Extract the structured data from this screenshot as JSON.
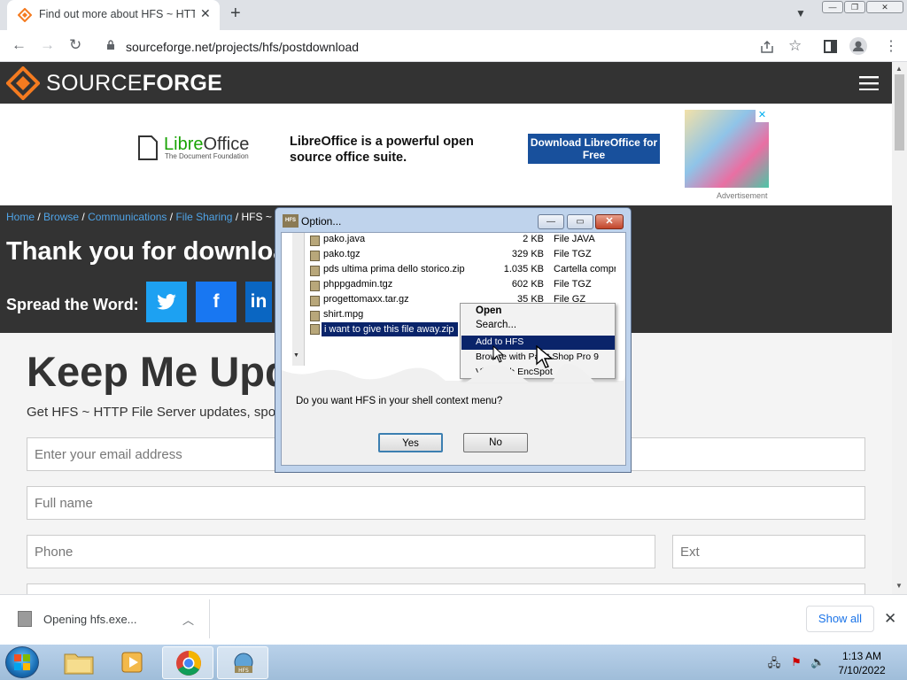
{
  "browser": {
    "tab_title": "Find out more about HFS ~ HTTP File Server",
    "url": "sourceforge.net/projects/hfs/postdownload"
  },
  "site": {
    "logo_light": "SOURCE",
    "logo_bold": "FORGE"
  },
  "ad": {
    "brand_a": "Libre",
    "brand_b": "Office",
    "brand_sub": "The Document Foundation",
    "text": "LibreOffice is a powerful open source office suite.",
    "cta": "Download LibreOffice for Free",
    "label": "Advertisement"
  },
  "breadcrumb": {
    "items": [
      "Home",
      "Browse",
      "Communications",
      "File Sharing"
    ],
    "current": "HFS ~ HTTP File Server"
  },
  "page": {
    "thanks": "Thank you for downloading",
    "spread": "Spread the Word:",
    "keep_me": "Keep Me Updated",
    "get_updates": "Get HFS ~ HTTP File Server updates, sponsored content from our select partners, and more."
  },
  "form": {
    "email_placeholder": "Enter your email address",
    "name_placeholder": "Full name",
    "phone_placeholder": "Phone",
    "ext_placeholder": "Ext"
  },
  "download_bar": {
    "file_text": "Opening hfs.exe...",
    "show_all": "Show all"
  },
  "dialog": {
    "title": "Option...",
    "files": [
      {
        "name": "pako.java",
        "size": "2 KB",
        "type": "File JAVA"
      },
      {
        "name": "pako.tgz",
        "size": "329 KB",
        "type": "File TGZ"
      },
      {
        "name": "pds ultima prima dello storico.zip",
        "size": "1.035 KB",
        "type": "Cartella compr"
      },
      {
        "name": "phppgadmin.tgz",
        "size": "602 KB",
        "type": "File TGZ"
      },
      {
        "name": "progettomaxx.tar.gz",
        "size": "35 KB",
        "type": "File GZ"
      },
      {
        "name": "shirt.mpg",
        "size": "",
        "type": ""
      },
      {
        "name": "i want to give this file away.zip",
        "size": "",
        "type": ""
      }
    ],
    "context_menu": [
      "Open",
      "Search...",
      "Add to HFS",
      "Browse with Paint Shop Pro 9",
      "View with EncSpot"
    ],
    "question": "Do you want HFS in your shell context menu?",
    "yes": "Yes",
    "no": "No"
  },
  "taskbar": {
    "time": "1:13 AM",
    "date": "7/10/2022"
  },
  "colors": {
    "sf_orange": "#f47b20",
    "sf_dark": "#333333",
    "link_blue": "#4fa3e6",
    "twitter": "#1da1f2",
    "facebook": "#1877f2",
    "linkedin": "#0a66c2"
  }
}
